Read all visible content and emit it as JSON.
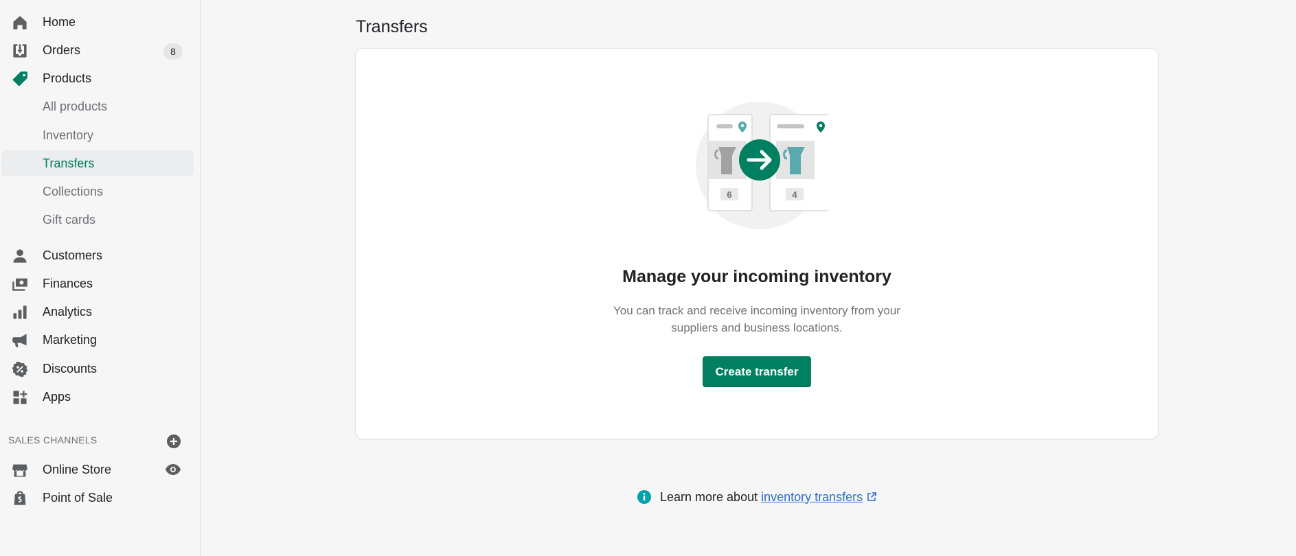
{
  "sidebar": {
    "items": [
      {
        "label": "Home",
        "icon": "home-icon"
      },
      {
        "label": "Orders",
        "icon": "orders-icon",
        "badge": "8"
      },
      {
        "label": "Products",
        "icon": "tag-icon"
      },
      {
        "label": "Customers",
        "icon": "person-icon"
      },
      {
        "label": "Finances",
        "icon": "finances-icon"
      },
      {
        "label": "Analytics",
        "icon": "bar-chart-icon"
      },
      {
        "label": "Marketing",
        "icon": "megaphone-icon"
      },
      {
        "label": "Discounts",
        "icon": "discount-icon"
      },
      {
        "label": "Apps",
        "icon": "apps-icon"
      }
    ],
    "product_subitems": [
      {
        "label": "All products"
      },
      {
        "label": "Inventory"
      },
      {
        "label": "Transfers",
        "selected": true
      },
      {
        "label": "Collections"
      },
      {
        "label": "Gift cards"
      }
    ],
    "sales_channels": {
      "title": "SALES CHANNELS",
      "items": [
        {
          "label": "Online Store",
          "icon": "store-icon"
        },
        {
          "label": "Point of Sale",
          "icon": "pos-bag-icon"
        }
      ]
    }
  },
  "main": {
    "title": "Transfers",
    "empty_state": {
      "heading": "Manage your incoming inventory",
      "description": "You can track and receive incoming inventory from your suppliers and business locations.",
      "button_label": "Create transfer",
      "illustration": {
        "left_count": "6",
        "right_count": "4"
      }
    },
    "footer": {
      "text": "Learn more about",
      "link_text": "inventory transfers"
    }
  },
  "colors": {
    "accent": "#008060",
    "link": "#2c6ecb",
    "info": "#00a0ac"
  }
}
